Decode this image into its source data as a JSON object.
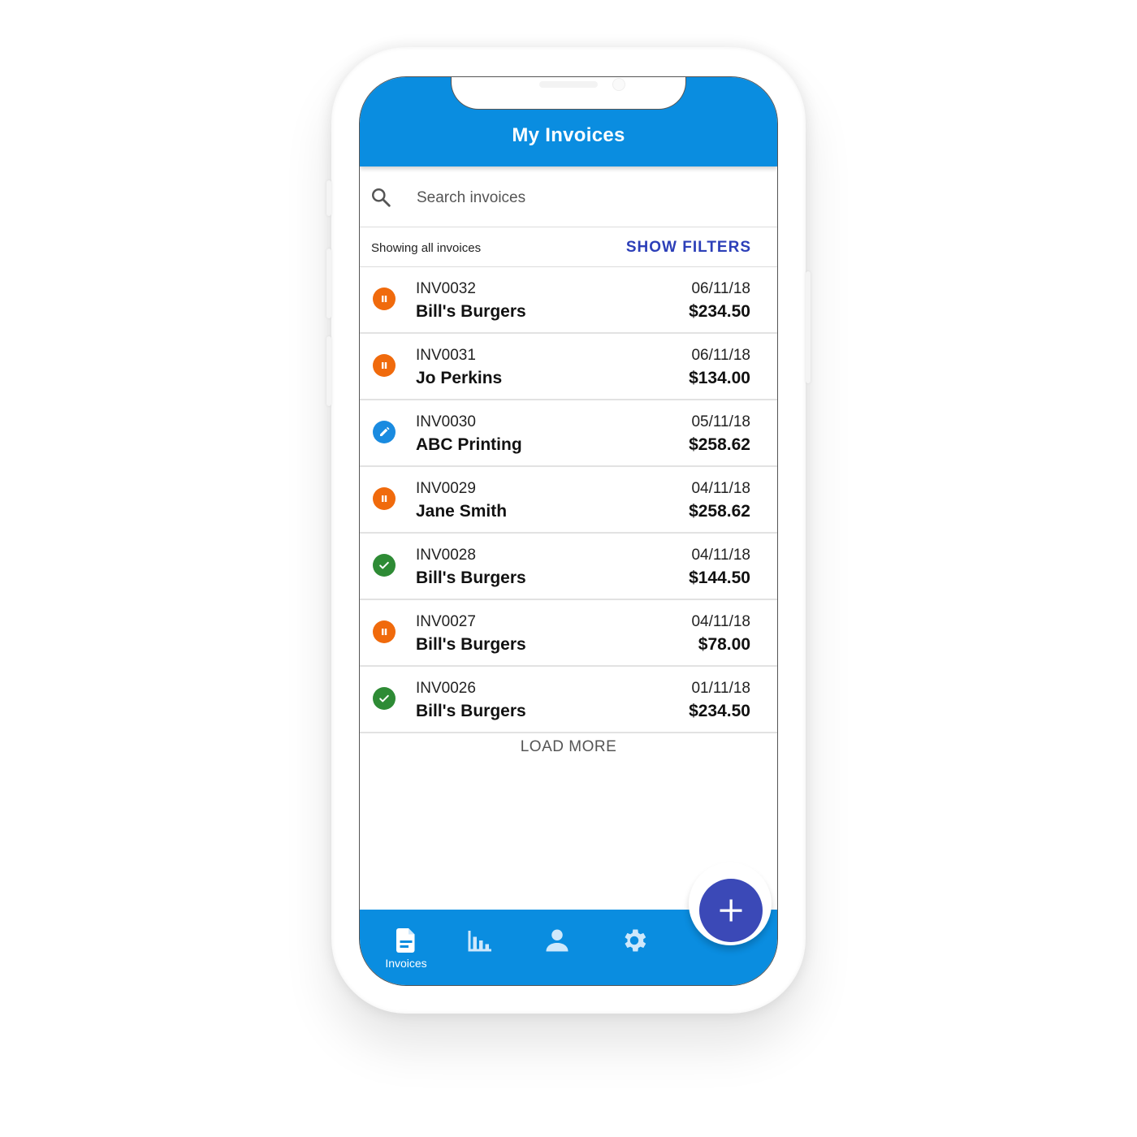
{
  "appbar": {
    "title": "My Invoices"
  },
  "search": {
    "placeholder": "Search invoices",
    "value": ""
  },
  "filterbar": {
    "status_text": "Showing all invoices",
    "show_filters_label": "SHOW FILTERS"
  },
  "colors": {
    "primary": "#0a8de0",
    "accent": "#3b49b7",
    "link": "#2c3fb8",
    "status_pending": "#f06a0c",
    "status_draft": "#1a8be0",
    "status_paid": "#2e8b35"
  },
  "invoices": [
    {
      "id": "INV0032",
      "client": "Bill's Burgers",
      "date": "06/11/18",
      "amount": "$234.50",
      "status": "pending",
      "status_icon": "pause-icon"
    },
    {
      "id": "INV0031",
      "client": "Jo Perkins",
      "date": "06/11/18",
      "amount": "$134.00",
      "status": "pending",
      "status_icon": "pause-icon"
    },
    {
      "id": "INV0030",
      "client": "ABC Printing",
      "date": "05/11/18",
      "amount": "$258.62",
      "status": "draft",
      "status_icon": "pencil-icon"
    },
    {
      "id": "INV0029",
      "client": "Jane Smith",
      "date": "04/11/18",
      "amount": "$258.62",
      "status": "pending",
      "status_icon": "pause-icon"
    },
    {
      "id": "INV0028",
      "client": "Bill's Burgers",
      "date": "04/11/18",
      "amount": "$144.50",
      "status": "paid",
      "status_icon": "check-icon"
    },
    {
      "id": "INV0027",
      "client": "Bill's Burgers",
      "date": "04/11/18",
      "amount": "$78.00",
      "status": "pending",
      "status_icon": "pause-icon"
    },
    {
      "id": "INV0026",
      "client": "Bill's Burgers",
      "date": "01/11/18",
      "amount": "$234.50",
      "status": "paid",
      "status_icon": "check-icon"
    }
  ],
  "load_more_label": "LOAD MORE",
  "bottom_nav": {
    "items": [
      {
        "label": "Invoices",
        "icon": "document-icon",
        "active": true
      },
      {
        "label": "",
        "icon": "bar-chart-icon",
        "active": false
      },
      {
        "label": "",
        "icon": "person-icon",
        "active": false
      },
      {
        "label": "",
        "icon": "gear-icon",
        "active": false
      }
    ]
  },
  "fab": {
    "icon": "plus-icon"
  }
}
